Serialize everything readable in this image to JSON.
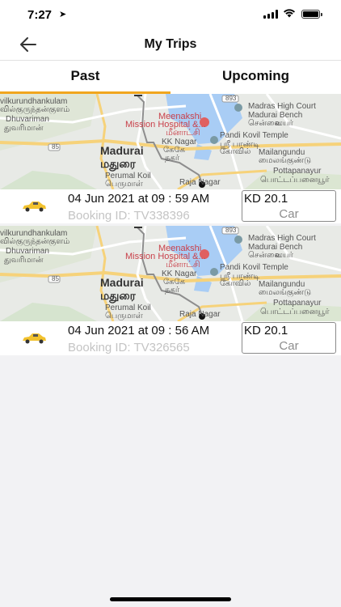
{
  "status_bar": {
    "time": "7:27",
    "location_arrow": "➤"
  },
  "nav": {
    "title": "My Trips",
    "back_icon": "back-arrow-icon"
  },
  "tabs": [
    {
      "label": "Past",
      "active": true
    },
    {
      "label": "Upcoming",
      "active": false
    }
  ],
  "accent_color": "#f1a61e",
  "map_labels": {
    "hospital": "Meenakshi",
    "hospital2": "Mission Hospital &...",
    "hospital_ta": "மீனாட்சி",
    "high_court": "Madras High Court",
    "bench": "Madurai Bench",
    "chennai_ta": "சென்னை",
    "court_ta": "உயர்",
    "madurai": "Madurai",
    "madurai_ta": "மதுரை",
    "kk_nagar": "KK Nagar",
    "kk_nagar_ta": "கேகே",
    "nagar_ta": "நகர்",
    "pandi": "Pandi Kovil Temple",
    "pandi_ta": "ஸ்ரீ பாண்டி",
    "kovil_ta": "கோவில்",
    "perumal": "Perumal Koil",
    "perumal_ta": "பெருமாள்",
    "koil_ta": "கோயில்",
    "dhuvariman": "Dhuvariman",
    "dhuvariman_ta": "துவரிமான்",
    "kulam": "vilkurundhankulam",
    "kulam_ta": "வில்குருந்தன்குளம்",
    "mailangundu": "Mailangundu",
    "mailangundu_ta": "மைலங்குண்டு",
    "pottapanayur": "Pottapanayur",
    "pottapanayur_ta": "பொட்டப்பனையூர்",
    "raja_nagar": "Raja Nagar",
    "road_85": "85",
    "road_893": "893"
  },
  "trips": [
    {
      "date": "04 Jun 2021 at 09 : 59 AM",
      "booking": "Booking ID: TV338396",
      "price": "KD 20.1",
      "vehicle": "Car"
    },
    {
      "date": "04 Jun 2021 at 09 : 56 AM",
      "booking": "Booking ID: TV326565",
      "price": "KD 20.1",
      "vehicle": "Car"
    }
  ]
}
